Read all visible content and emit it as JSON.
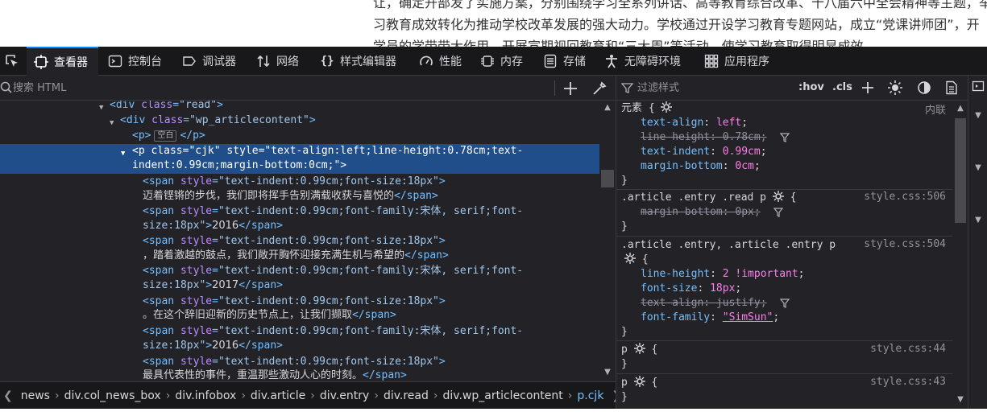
{
  "webpage": {
    "line1": "让，确定开部发了实施方案，分别围绕学习全系列讲话、高等教育综合改革、十八届六中全会精神等主题，举",
    "line2": "习教育成效转化为推动学校改革发展的强大动力。学校通过开设学习教育专题网站，成立“党课讲师团”，开",
    "line3": "学员的学带带大作用，开展宣期视回教育和“三大周”等活动，使学习教育取得明显成效。"
  },
  "tabs": [
    {
      "label": "查看器",
      "icon": "inspector-icon",
      "active": true
    },
    {
      "label": "控制台",
      "icon": "console-icon"
    },
    {
      "label": "调试器",
      "icon": "debugger-icon"
    },
    {
      "label": "网络",
      "icon": "network-icon"
    },
    {
      "label": "样式编辑器",
      "icon": "style-editor-icon"
    },
    {
      "label": "性能",
      "icon": "performance-icon"
    },
    {
      "label": "内存",
      "icon": "memory-icon"
    },
    {
      "label": "存储",
      "icon": "storage-icon"
    },
    {
      "label": "无障碍环境",
      "icon": "accessibility-icon"
    },
    {
      "label": "应用程序",
      "icon": "application-icon"
    }
  ],
  "markup": {
    "search_placeholder": "搜索 HTML",
    "rows": [
      {
        "t1": "<div ",
        "a1": "class",
        "v1": "\"read\"",
        "t2": ">"
      },
      {
        "t1": "<div ",
        "a1": "class",
        "v1": "\"wp_articlecontent\"",
        "t2": ">"
      },
      {
        "t1": "<p>",
        "badge": "空白",
        "t2": "</p>"
      },
      {
        "t1": "<p ",
        "a1": "class",
        "v1": "\"cjk\"",
        "a2": "style",
        "v2a": "\"text-align:left;line-height:0.78cm;text-",
        "v2b": "indent:0.99cm;margin-bottom:0cm;\"",
        "t2": ">"
      },
      {
        "open": "<span ",
        "attr": "style",
        "val": "\"text-indent:0.99cm;font-size:18px\"",
        "close": ">",
        "text": "迈着铿锵的步伐，我们即将挥手告别满载收获与喜悦的",
        "end": "</span>"
      },
      {
        "open": "<span ",
        "attr": "style",
        "val_a": "\"text-indent:0.99cm;font-family:宋体, serif;font-",
        "val_b": "size:18px\"",
        "close": ">",
        "text": "2016",
        "end": "</span>"
      },
      {
        "open": "<span ",
        "attr": "style",
        "val": "\"text-indent:0.99cm;font-size:18px\"",
        "close": ">",
        "text": "，踏着激越的鼓点，我们敞开胸怀迎接充满生机与希望的",
        "end": "</span>"
      },
      {
        "open": "<span ",
        "attr": "style",
        "val_a": "\"text-indent:0.99cm;font-family:宋体, serif;font-",
        "val_b": "size:18px\"",
        "close": ">",
        "text": "2017",
        "end": "</span>"
      },
      {
        "open": "<span ",
        "attr": "style",
        "val": "\"text-indent:0.99cm;font-size:18px\"",
        "close": ">",
        "text": "。在这个辞旧迎新的历史节点上，让我们撷取",
        "end": "</span>"
      },
      {
        "open": "<span ",
        "attr": "style",
        "val_a": "\"text-indent:0.99cm;font-family:宋体, serif;font-",
        "val_b": "size:18px\"",
        "close": ">",
        "text": "2016",
        "end": "</span>"
      },
      {
        "open": "<span ",
        "attr": "style",
        "val": "\"text-indent:0.99cm;font-size:18px\"",
        "close": ">",
        "text": "最具代表性的事件，重温那些激动人心的时刻。",
        "end": "</span>"
      }
    ],
    "breadcrumbs": [
      "news",
      "div.col_news_box",
      "div.infobox",
      "div.article",
      "div.entry",
      "div.read",
      "div.wp_articlecontent",
      "p.cjk"
    ]
  },
  "rules": {
    "filter_placeholder": "过滤样式",
    "hov": ":hov",
    "cls": ".cls",
    "element": {
      "selector": "元素 {",
      "source": "内联",
      "decls": [
        {
          "prop": "text-align",
          "val": "left"
        },
        {
          "prop": "line-height",
          "val": "0.78cm",
          "overridden": true
        },
        {
          "prop": "text-indent",
          "val": "0.99cm"
        },
        {
          "prop": "margin-bottom",
          "val": "0cm"
        }
      ]
    },
    "rule2": {
      "selector": ".article .entry .read p",
      "source": "style.css:506",
      "decls": [
        {
          "prop": "margin-bottom",
          "val": "0px",
          "overridden": true
        }
      ]
    },
    "rule3": {
      "selector": ".article .entry, .article .entry p",
      "source": "style.css:504",
      "decls": [
        {
          "prop": "line-height",
          "val": "2 !important"
        },
        {
          "prop": "font-size",
          "val": "18px"
        },
        {
          "prop": "text-align",
          "val": "justify",
          "overridden": true
        },
        {
          "prop": "font-family",
          "val": "\"SimSun\""
        }
      ]
    },
    "rule4": {
      "selector": "p",
      "source": "style.css:44"
    },
    "rule5": {
      "selector": "p",
      "source": "style.css:43"
    },
    "close_brace": "}",
    "open_brace": "{"
  },
  "colors": {
    "accent": "#0a84ff",
    "selection": "#204e8a",
    "tag": "#75bfff",
    "attr": "#b98eff",
    "value": "#ff7de9"
  }
}
